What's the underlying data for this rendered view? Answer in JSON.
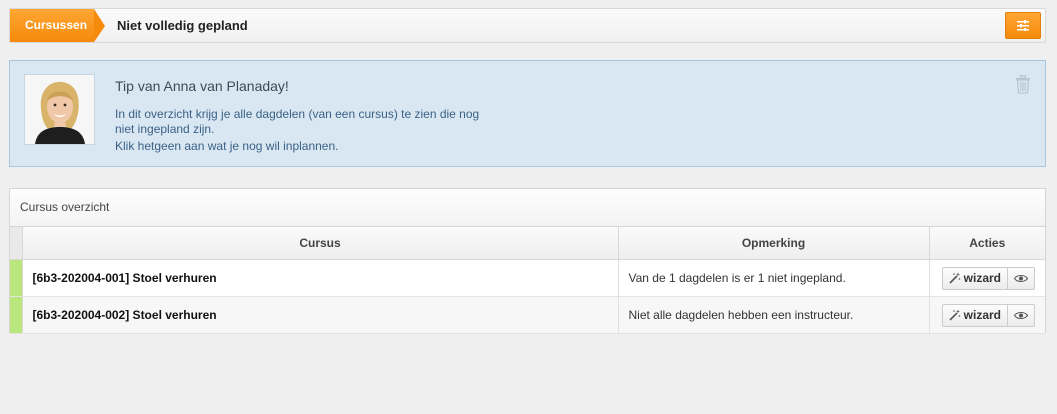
{
  "breadcrumb": {
    "home_label": "Cursussen",
    "current_label": "Niet volledig gepland"
  },
  "tip": {
    "title": "Tip van Anna van Planaday!",
    "lines": [
      "In dit overzicht krijg je alle dagdelen (van een cursus) te zien die nog",
      "niet ingepland zijn.",
      "Klik hetgeen aan wat je nog wil inplannen."
    ]
  },
  "panel": {
    "title": "Cursus overzicht",
    "columns": [
      "Cursus",
      "Opmerking",
      "Acties"
    ],
    "rows": [
      {
        "course": "[6b3-202004-001] Stoel verhuren",
        "remark": "Van de 1 dagdelen is er 1 niet ingepland.",
        "wizard_label": "wizard",
        "status_color": "#b9e77b"
      },
      {
        "course": "[6b3-202004-002] Stoel verhuren",
        "remark": "Niet alle dagdelen hebben een instructeur.",
        "wizard_label": "wizard",
        "status_color": "#b9e77b"
      }
    ]
  },
  "icons": {
    "settings": "sliders-icon",
    "trash": "trash-icon",
    "wizard": "magic-wand-icon",
    "view": "eye-icon"
  },
  "colors": {
    "accent": "#f58a0b",
    "tip_bg": "#d9e7f3",
    "tip_text": "#3b6185"
  }
}
